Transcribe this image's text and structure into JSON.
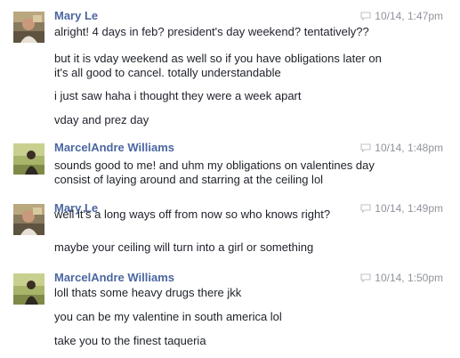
{
  "colors": {
    "sender_name": "#4b67a1",
    "timestamp": "#90949c",
    "message_text": "#1d2129",
    "background": "#ffffff"
  },
  "messages": [
    {
      "sender": "Mary Le",
      "timestamp": "10/14, 1:47pm",
      "avatar_icon": "profile-photo",
      "lines": [
        "alright! 4 days in feb? president's day weekend? tentatively??",
        "but it is vday weekend as well so if you have obligations later on",
        "it's all good to cancel. totally understandable",
        "i just saw haha i thought they were a week apart",
        "vday and prez day"
      ]
    },
    {
      "sender": "MarcelAndre Williams",
      "timestamp": "10/14, 1:48pm",
      "avatar_icon": "profile-photo",
      "lines": [
        "sounds good to me! and uhm my obligations on valentines day",
        "consist of laying around and starring at the ceiling lol"
      ]
    },
    {
      "sender": "Mary Le",
      "timestamp": "10/14, 1:49pm",
      "avatar_icon": "profile-photo",
      "lines": [
        "well it's a long ways off from now so who knows right?",
        "maybe your ceiling will turn into a girl or something"
      ]
    },
    {
      "sender": "MarcelAndre Williams",
      "timestamp": "10/14, 1:50pm",
      "avatar_icon": "profile-photo",
      "lines": [
        "loll thats some heavy drugs there jkk",
        "you can be my valentine in south america lol",
        "take you to the finest taqueria"
      ]
    }
  ]
}
